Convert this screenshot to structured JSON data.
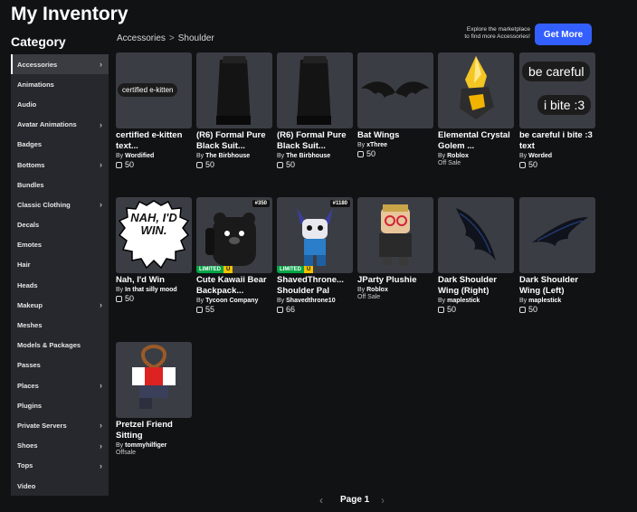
{
  "header": {
    "title": "My Inventory"
  },
  "sidebar": {
    "title": "Category",
    "items": [
      {
        "label": "Accessories",
        "chevron": true,
        "active": true
      },
      {
        "label": "Animations",
        "chevron": false
      },
      {
        "label": "Audio",
        "chevron": false
      },
      {
        "label": "Avatar Animations",
        "chevron": true
      },
      {
        "label": "Badges",
        "chevron": false
      },
      {
        "label": "Bottoms",
        "chevron": true
      },
      {
        "label": "Bundles",
        "chevron": false
      },
      {
        "label": "Classic Clothing",
        "chevron": true
      },
      {
        "label": "Decals",
        "chevron": false
      },
      {
        "label": "Emotes",
        "chevron": false
      },
      {
        "label": "Hair",
        "chevron": false
      },
      {
        "label": "Heads",
        "chevron": false
      },
      {
        "label": "Makeup",
        "chevron": true
      },
      {
        "label": "Meshes",
        "chevron": false
      },
      {
        "label": "Models & Packages",
        "chevron": false
      },
      {
        "label": "Passes",
        "chevron": false
      },
      {
        "label": "Places",
        "chevron": true
      },
      {
        "label": "Plugins",
        "chevron": false
      },
      {
        "label": "Private Servers",
        "chevron": true
      },
      {
        "label": "Shoes",
        "chevron": true
      },
      {
        "label": "Tops",
        "chevron": true
      },
      {
        "label": "Video",
        "chevron": false
      }
    ]
  },
  "breadcrumb": {
    "root": "Accessories",
    "separator": ">",
    "current": "Shoulder"
  },
  "promo": {
    "line1": "Explore the marketplace",
    "line2": "to find more Accessories!",
    "button": "Get More"
  },
  "items": [
    {
      "name": "certified e-kitten text...",
      "by": "By",
      "creator": "Wordified",
      "price": "50",
      "thumb_text": "certified e-kitten"
    },
    {
      "name": "(R6) Formal Pure Black Suit...",
      "by": "By",
      "creator": "The Birbhouse",
      "price": "50"
    },
    {
      "name": "(R6) Formal Pure Black Suit...",
      "by": "By",
      "creator": "The Birbhouse",
      "price": "50"
    },
    {
      "name": "Bat Wings",
      "by": "By",
      "creator": "xThree",
      "price": "50"
    },
    {
      "name": "Elemental Crystal Golem ...",
      "by": "By",
      "creator": "Roblox",
      "status": "Off Sale"
    },
    {
      "name": "be careful i bite :3 text",
      "by": "By",
      "creator": "Worded",
      "price": "50",
      "thumb_text": "be careful",
      "thumb_text2": "i bite :3"
    },
    {
      "name": "Nah, I'd Win",
      "by": "By",
      "creator": "In that silly mood",
      "price": "50",
      "thumb_text": "NAH, I'D WIN."
    },
    {
      "name": "Cute Kawaii Bear Backpack...",
      "by": "By",
      "creator": "Tycoon Company",
      "price": "55",
      "serial": "#350",
      "limited": "LIMITED",
      "u": "U"
    },
    {
      "name": "ShavedThrone... Shoulder Pal",
      "by": "By",
      "creator": "Shavedthrone10",
      "price": "66",
      "serial": "#1180",
      "limited": "LIMITED",
      "u": "U"
    },
    {
      "name": "JParty Plushie",
      "by": "By",
      "creator": "Roblox",
      "status": "Off Sale"
    },
    {
      "name": "Dark Shoulder Wing (Right)",
      "by": "By",
      "creator": "maplestick",
      "price": "50"
    },
    {
      "name": "Dark Shoulder Wing (Left)",
      "by": "By",
      "creator": "maplestick",
      "price": "50"
    },
    {
      "name": "Pretzel Friend Sitting",
      "by": "By",
      "creator": "tommyhilfiger",
      "status": "Offsale"
    }
  ],
  "pagination": {
    "prev": "‹",
    "label": "Page 1",
    "next": "›"
  },
  "colors": {
    "accent": "#335fff",
    "background": "#111214",
    "sidebar": "#26282d",
    "thumb": "#3b3d44",
    "limited": "#00a445",
    "unique": "#f2c200"
  }
}
